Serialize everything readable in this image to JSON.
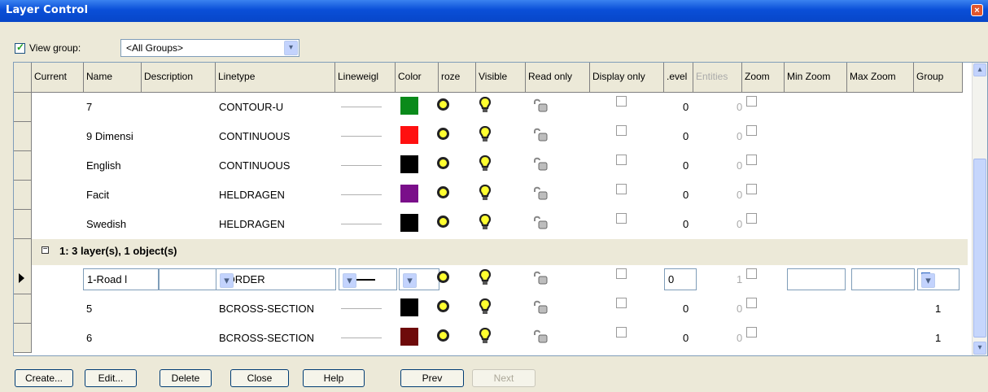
{
  "window": {
    "title": "Layer Control",
    "close_glyph": "×"
  },
  "toolbar": {
    "view_group_label": "View group:",
    "view_group_checked": true,
    "group_select_value": "<All Groups>"
  },
  "columns": [
    "Current",
    "Name",
    "Description",
    "Linetype",
    "Lineweigl",
    "Color",
    "Froze",
    "Visible",
    "Read only",
    "Display only",
    "Level",
    "Entities",
    "Zoom",
    "Min Zoom",
    "Max Zoom",
    "Group"
  ],
  "column_display": [
    "Current",
    "Name",
    "Description",
    "Linetype",
    "Lineweigl",
    "Color",
    "roze",
    "Visible",
    "Read only",
    "Display only",
    ".evel",
    "Entities",
    "Zoom",
    "Min Zoom",
    "Max Zoom",
    "Group"
  ],
  "rows": [
    {
      "name": "7",
      "linetype": "CONTOUR-U",
      "color": "#0a8a1a",
      "level": "0",
      "entities": "0",
      "group": ""
    },
    {
      "name": "9 Dimensi",
      "linetype": "CONTINUOUS",
      "color": "#ff1010",
      "level": "0",
      "entities": "0",
      "group": ""
    },
    {
      "name": "English",
      "linetype": "CONTINUOUS",
      "color": "#000000",
      "level": "0",
      "entities": "0",
      "group": ""
    },
    {
      "name": "Facit",
      "linetype": "HELDRAGEN",
      "color": "#7a0f8a",
      "level": "0",
      "entities": "0",
      "group": ""
    },
    {
      "name": "Swedish",
      "linetype": "HELDRAGEN",
      "color": "#000000",
      "level": "0",
      "entities": "0",
      "group": ""
    }
  ],
  "group_header": {
    "text": "1: 3 layer(s), 1 object(s)",
    "collapse_glyph": "−"
  },
  "editing_row": {
    "name": "1-Road l",
    "linetype": "BORDER",
    "color": "#0a1ef0",
    "level": "0",
    "entities": "1",
    "group": "1"
  },
  "group_rows": [
    {
      "name": "5",
      "linetype": "BCROSS-SECTION",
      "color": "#000000",
      "level": "0",
      "entities": "0",
      "group": "1"
    },
    {
      "name": "6",
      "linetype": "BCROSS-SECTION",
      "color": "#6e0a0a",
      "level": "0",
      "entities": "0",
      "group": "1"
    }
  ],
  "buttons": {
    "create": "Create...",
    "edit": "Edit...",
    "delete": "Delete",
    "close": "Close",
    "help": "Help",
    "prev": "Prev",
    "next": "Next"
  },
  "icons": {
    "dropdown": "▾",
    "scroll_up": "▴",
    "scroll_down": "▾",
    "froze": "froze-circle-icon",
    "visible": "lightbulb-icon",
    "readonly": "unlocked-padlock-icon"
  }
}
